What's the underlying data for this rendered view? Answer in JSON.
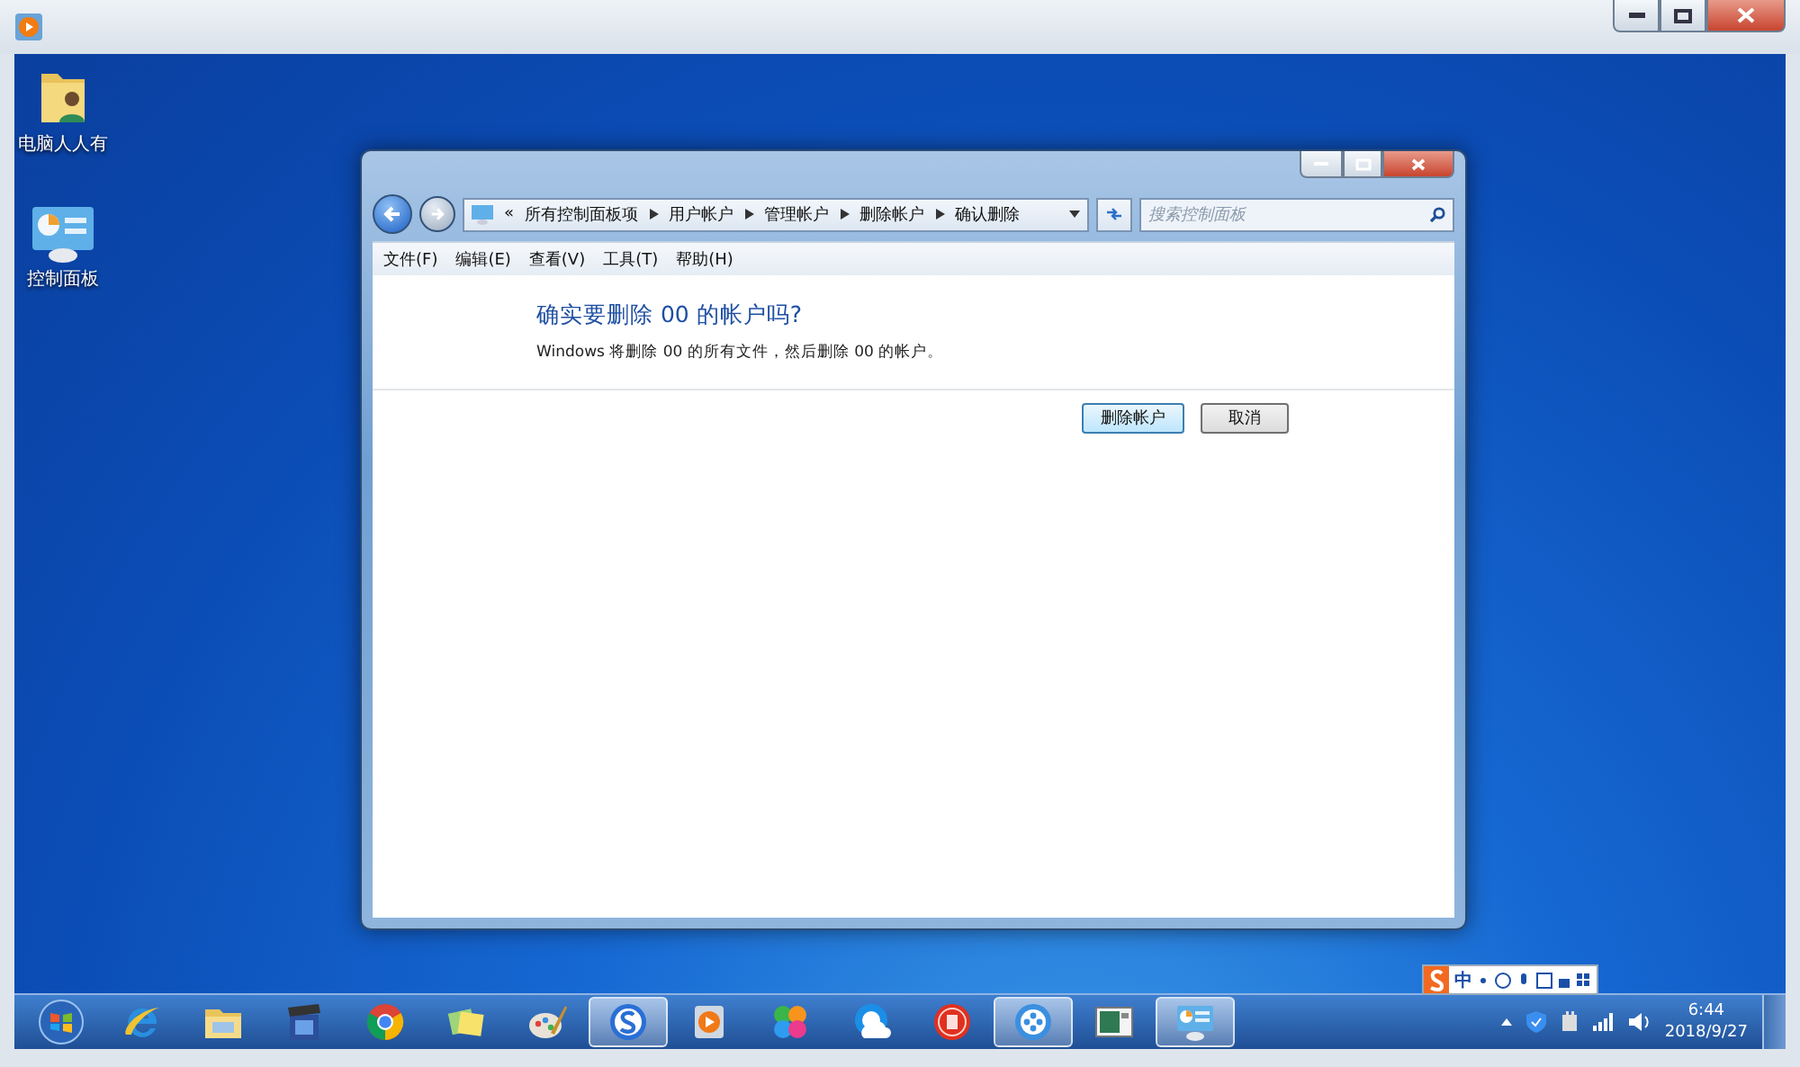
{
  "desktop_icons": [
    {
      "kind": "user-folder",
      "label": "电脑人人有"
    },
    {
      "kind": "control-panel",
      "label": "控制面板"
    }
  ],
  "explorer": {
    "overflow": "«",
    "breadcrumb": [
      "所有控制面板项",
      "用户帐户",
      "管理帐户",
      "删除帐户",
      "确认删除"
    ],
    "search": {
      "placeholder": "搜索控制面板"
    },
    "menu": [
      "文件(F)",
      "编辑(E)",
      "查看(V)",
      "工具(T)",
      "帮助(H)"
    ],
    "heading": "确实要删除 00 的帐户吗?",
    "message": "Windows 将删除 00 的所有文件，然后删除 00 的帐户。",
    "buttons": [
      {
        "label": "删除帐户",
        "selected": true
      },
      {
        "label": "取消",
        "selected": false
      }
    ]
  },
  "taskbar": {
    "apps": [
      {
        "kind": "ie",
        "active": false
      },
      {
        "kind": "folder",
        "active": false
      },
      {
        "kind": "movie",
        "active": false
      },
      {
        "kind": "chrome",
        "active": false
      },
      {
        "kind": "notes",
        "active": false
      },
      {
        "kind": "paint",
        "active": false
      },
      {
        "kind": "sogou",
        "active": true
      },
      {
        "kind": "player",
        "active": false
      },
      {
        "kind": "pinwheel",
        "active": false
      },
      {
        "kind": "cloud",
        "active": false
      },
      {
        "kind": "chess",
        "active": false
      },
      {
        "kind": "reel",
        "active": true
      },
      {
        "kind": "screen",
        "active": false
      },
      {
        "kind": "control-panel",
        "active": true
      }
    ]
  },
  "ime": {
    "mode": "中"
  },
  "clock": {
    "time": "6:44",
    "date": "2018/9/27"
  }
}
